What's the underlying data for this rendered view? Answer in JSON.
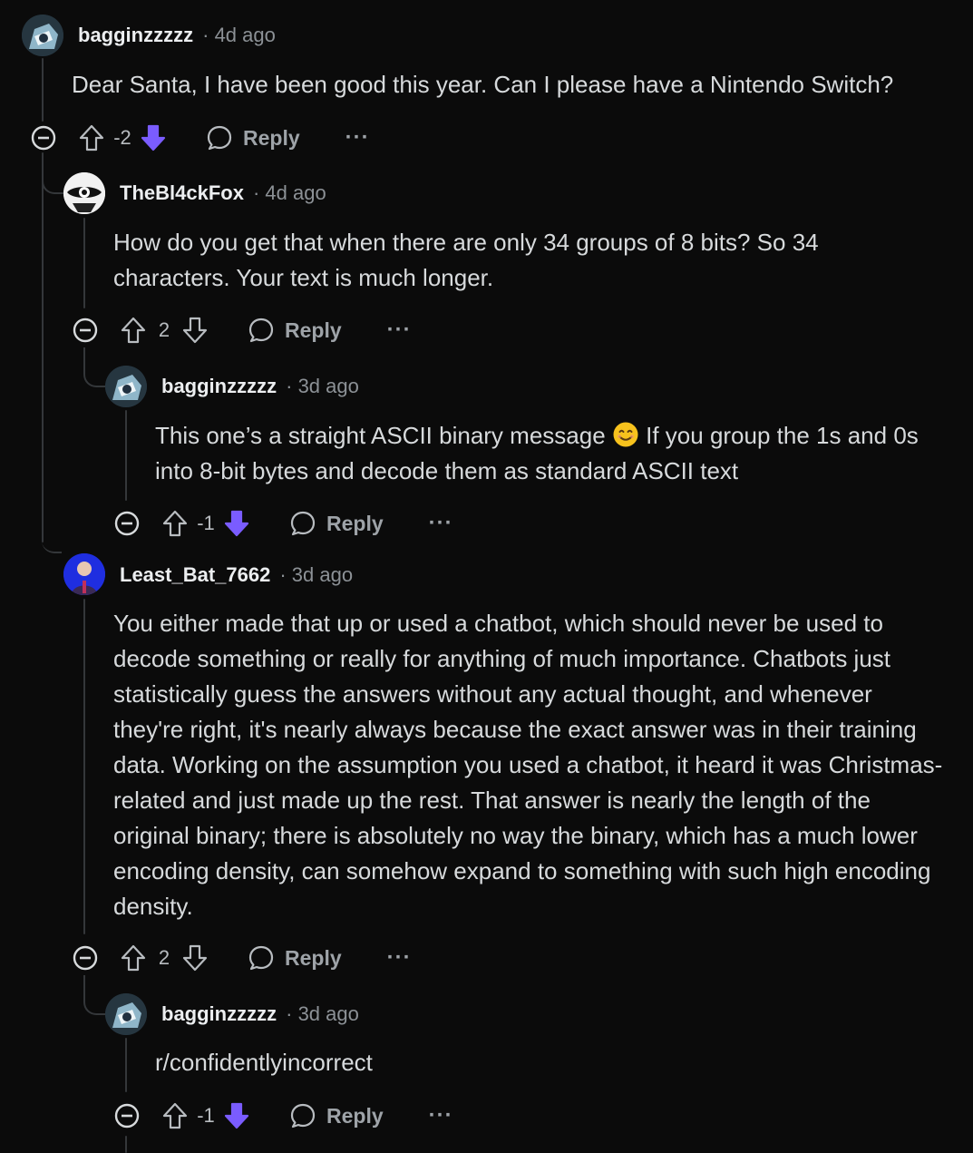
{
  "comments": [
    {
      "username": "bagginzzzzz",
      "time": "4d ago",
      "text": "Dear Santa, I have been good this year. Can I please have a Nintendo Switch?",
      "score": "-2",
      "vote": "down",
      "reply_label": "Reply",
      "more_label": "···"
    },
    {
      "username": "TheBl4ckFox",
      "time": "4d ago",
      "text": "How do you get that when there are only 34 groups of 8 bits? So 34 characters. Your text is much longer.",
      "score": "2",
      "vote": "none",
      "reply_label": "Reply",
      "more_label": "···"
    },
    {
      "username": "bagginzzzzz",
      "time": "3d ago",
      "text_before_emoji": "This one’s a straight ASCII binary message",
      "text_after_emoji": "If you group the 1s and 0s into 8-bit bytes and decode them as standard ASCII text",
      "score": "-1",
      "vote": "down",
      "reply_label": "Reply",
      "more_label": "···"
    },
    {
      "username": "Least_Bat_7662",
      "time": "3d ago",
      "text": "You either made that up or used a chatbot, which should never be used to decode something or really for anything of much importance. Chatbots just statistically guess the answers without any actual thought, and whenever they're right, it's nearly always because the exact answer was in their training data. Working on the assumption you used a chatbot, it heard it was Christmas-related and just made up the rest. That answer is nearly the length of the original binary; there is absolutely no way the binary, which has a much lower encoding density, can somehow expand to something with such high encoding density.",
      "score": "2",
      "vote": "none",
      "reply_label": "Reply",
      "more_label": "···"
    },
    {
      "username": "bagginzzzzz",
      "time": "3d ago",
      "text": "r/confidentlyincorrect",
      "score": "-1",
      "vote": "down",
      "reply_label": "Reply",
      "more_label": "···"
    }
  ],
  "colors": {
    "background": "#0b0b0b",
    "downvote_active": "#7a5cff",
    "thread_line": "#34373a",
    "muted_text": "#8c9196"
  }
}
